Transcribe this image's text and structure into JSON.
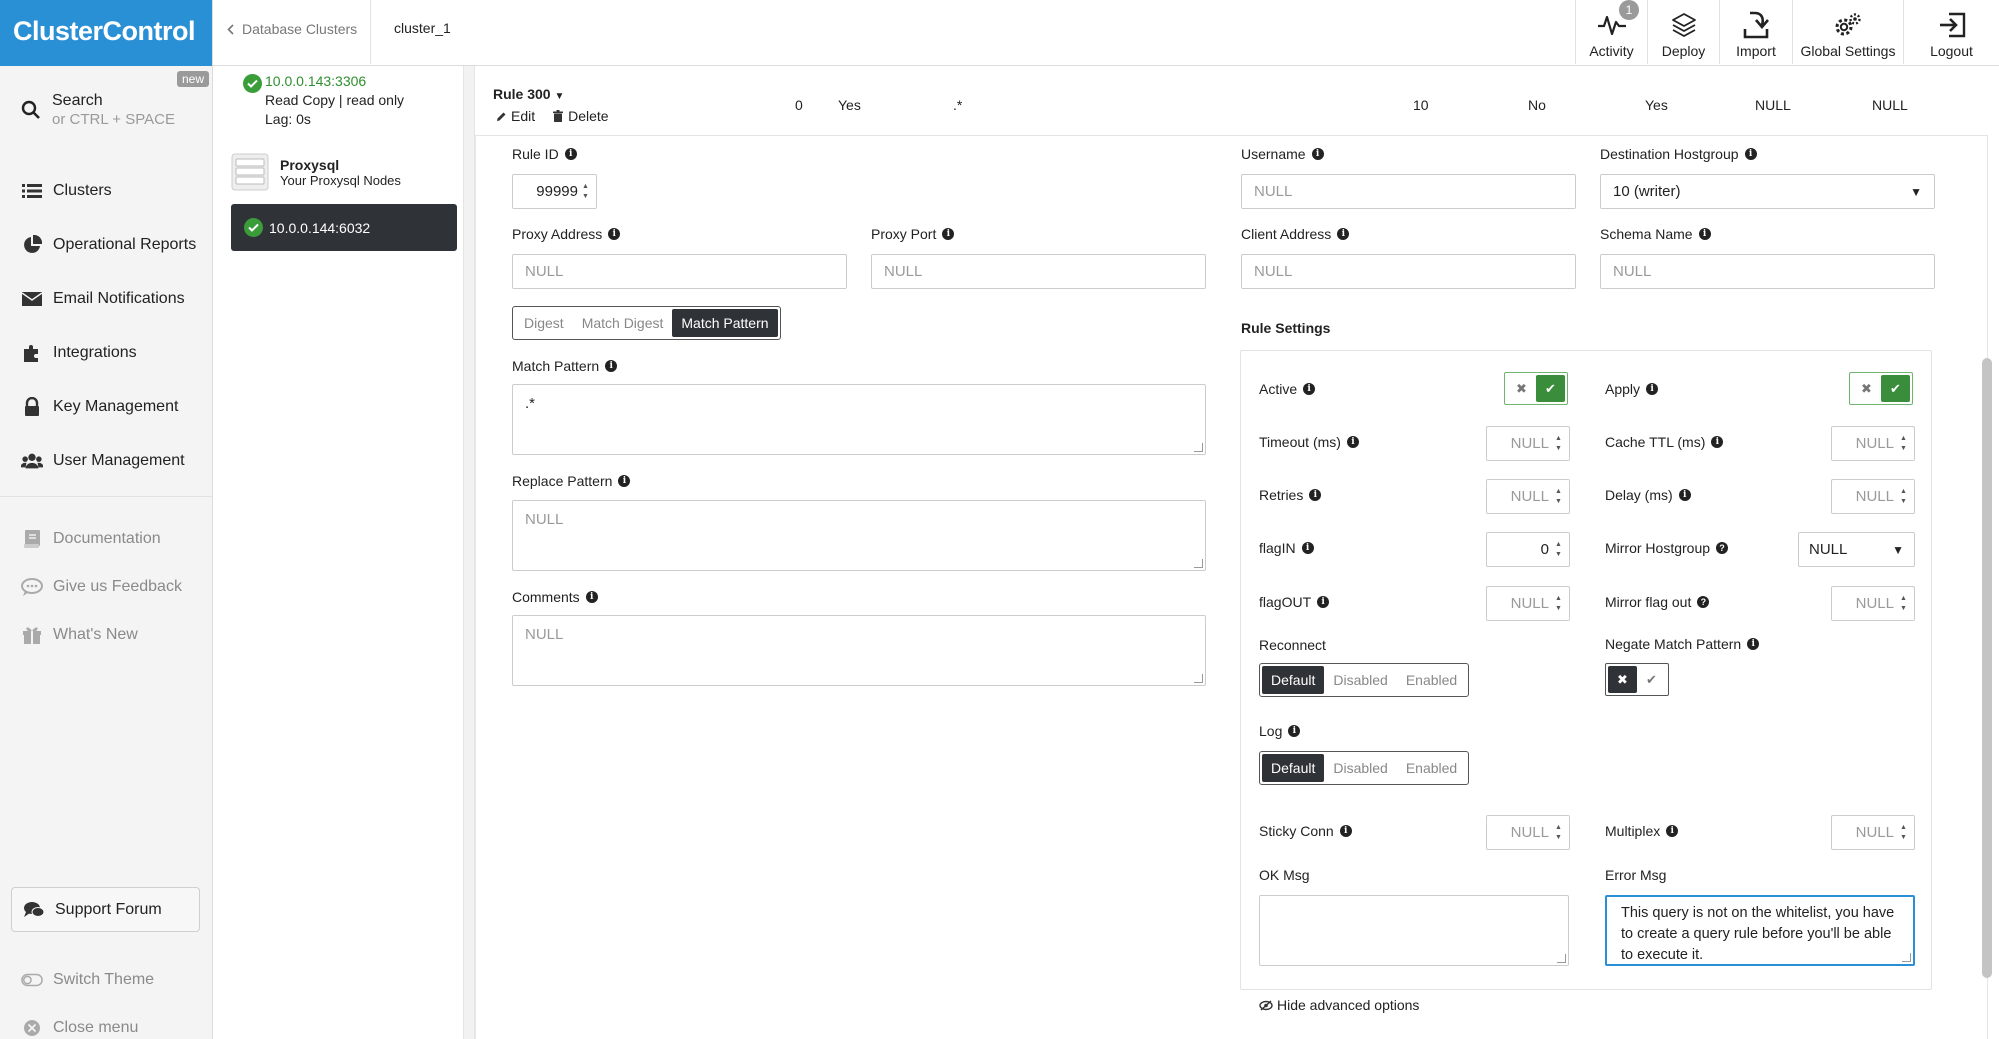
{
  "app": {
    "logo": "ClusterControl"
  },
  "nav": {
    "new_badge": "new",
    "search": {
      "label": "Search",
      "hint": "or CTRL + SPACE"
    },
    "items": [
      {
        "label": "Clusters",
        "icon": "list-icon"
      },
      {
        "label": "Operational Reports",
        "icon": "pie-chart-icon"
      },
      {
        "label": "Email Notifications",
        "icon": "envelope-icon"
      },
      {
        "label": "Integrations",
        "icon": "puzzle-icon"
      },
      {
        "label": "Key Management",
        "icon": "lock-icon"
      },
      {
        "label": "User Management",
        "icon": "users-icon"
      }
    ],
    "secondary": [
      {
        "label": "Documentation",
        "icon": "book-icon"
      },
      {
        "label": "Give us Feedback",
        "icon": "chat-icon"
      },
      {
        "label": "What's New",
        "icon": "gift-icon"
      }
    ],
    "support_forum": "Support Forum",
    "switch_theme": "Switch Theme",
    "close_menu": "Close menu"
  },
  "breadcrumb": {
    "parent": "Database Clusters",
    "current": "cluster_1"
  },
  "toolbar": {
    "activity": "Activity",
    "activity_badge": "1",
    "deploy": "Deploy",
    "import": "Import",
    "global_settings": "Global Settings",
    "logout": "Logout"
  },
  "cluster_list": {
    "node1": {
      "address": "10.0.0.143:3306",
      "role": "Read Copy | read only",
      "lag": "Lag: 0s"
    },
    "proxy": {
      "title": "Proxysql",
      "subtitle": "Your Proxysql Nodes"
    },
    "selected_node": "10.0.0.144:6032"
  },
  "rule_row": {
    "title": "Rule 300",
    "edit": "Edit",
    "delete": "Delete",
    "cells": [
      "0",
      "Yes",
      ".*",
      "10",
      "No",
      "Yes",
      "NULL",
      "NULL"
    ]
  },
  "form": {
    "rule_id": {
      "label": "Rule ID",
      "value": "99999"
    },
    "username": {
      "label": "Username",
      "placeholder": "NULL"
    },
    "dest_hostgroup": {
      "label": "Destination Hostgroup",
      "value": "10 (writer)"
    },
    "proxy_address": {
      "label": "Proxy Address",
      "placeholder": "NULL"
    },
    "proxy_port": {
      "label": "Proxy Port",
      "placeholder": "NULL"
    },
    "client_address": {
      "label": "Client Address",
      "placeholder": "NULL"
    },
    "schema_name": {
      "label": "Schema Name",
      "placeholder": "NULL"
    },
    "match_mode": {
      "options": [
        "Digest",
        "Match Digest",
        "Match Pattern"
      ],
      "selected": "Match Pattern"
    },
    "match_pattern": {
      "label": "Match Pattern",
      "value": ".*"
    },
    "replace_pattern": {
      "label": "Replace Pattern",
      "placeholder": "NULL"
    },
    "comments": {
      "label": "Comments",
      "placeholder": "NULL"
    }
  },
  "rule_settings": {
    "title": "Rule Settings",
    "active": "Active",
    "apply": "Apply",
    "timeout": {
      "label": "Timeout (ms)",
      "value": "NULL"
    },
    "cache_ttl": {
      "label": "Cache TTL (ms)",
      "value": "NULL"
    },
    "retries": {
      "label": "Retries",
      "value": "NULL"
    },
    "delay": {
      "label": "Delay (ms)",
      "value": "NULL"
    },
    "flag_in": {
      "label": "flagIN",
      "value": "0"
    },
    "mirror_hostgroup": {
      "label": "Mirror Hostgroup",
      "value": "NULL"
    },
    "flag_out": {
      "label": "flagOUT",
      "value": "NULL"
    },
    "mirror_flag_out": {
      "label": "Mirror flag out",
      "value": "NULL"
    },
    "reconnect": {
      "label": "Reconnect",
      "options": [
        "Default",
        "Disabled",
        "Enabled"
      ],
      "selected": "Default"
    },
    "negate_match_pattern": "Negate Match Pattern",
    "log": {
      "label": "Log",
      "options": [
        "Default",
        "Disabled",
        "Enabled"
      ],
      "selected": "Default"
    },
    "sticky_conn": {
      "label": "Sticky Conn",
      "value": "NULL"
    },
    "multiplex": {
      "label": "Multiplex",
      "value": "NULL"
    },
    "ok_msg": {
      "label": "OK Msg",
      "value": ""
    },
    "error_msg": {
      "label": "Error Msg",
      "value": "This query is not on the whitelist, you have to create a query rule before you'll be able to execute it."
    },
    "hide_advanced": "Hide advanced options"
  },
  "colors": {
    "brand": "#2a90d6",
    "success": "#3a9d3a",
    "dark": "#2f3236"
  }
}
